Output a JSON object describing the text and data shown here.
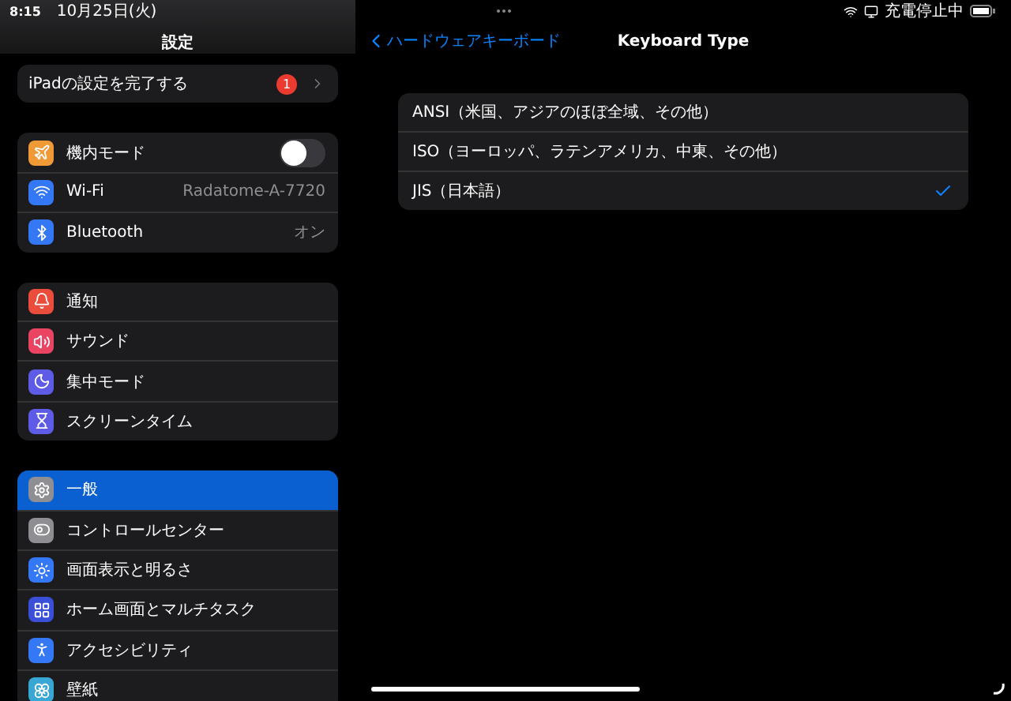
{
  "status_bar": {
    "time": "8:15",
    "date": "10月25日(火)",
    "charging": "充電停止中"
  },
  "sidebar": {
    "title": "設定",
    "setup_row": {
      "label": "iPadの設定を完了する",
      "badge": "1"
    },
    "groups": [
      {
        "items": [
          {
            "kind": "toggle",
            "label": "機内モード",
            "color": "#f09a37",
            "on": false
          },
          {
            "kind": "value",
            "label": "Wi-Fi",
            "color": "#3478f6",
            "value": "Radatome-A-7720"
          },
          {
            "kind": "value",
            "label": "Bluetooth",
            "color": "#3478f6",
            "value": "オン"
          }
        ]
      },
      {
        "items": [
          {
            "kind": "plain",
            "label": "通知",
            "color": "#eb4d3d"
          },
          {
            "kind": "plain",
            "label": "サウンド",
            "color": "#eb4463"
          },
          {
            "kind": "plain",
            "label": "集中モード",
            "color": "#5e5ce6"
          },
          {
            "kind": "plain",
            "label": "スクリーンタイム",
            "color": "#5e5ce6"
          }
        ]
      },
      {
        "items": [
          {
            "kind": "plain",
            "label": "一般",
            "color": "#8e8e93",
            "selected": true
          },
          {
            "kind": "plain",
            "label": "コントロールセンター",
            "color": "#8e8e93",
            "selected": false
          },
          {
            "kind": "plain",
            "label": "画面表示と明るさ",
            "color": "#3478f6",
            "selected": false
          },
          {
            "kind": "plain",
            "label": "ホーム画面とマルチタスク",
            "color": "#3a4fd8",
            "selected": false
          },
          {
            "kind": "plain",
            "label": "アクセシビリティ",
            "color": "#3478f6",
            "selected": false
          },
          {
            "kind": "plain",
            "label": "壁紙",
            "color": "#38a7d4",
            "selected": false
          }
        ]
      }
    ]
  },
  "detail": {
    "back": "ハードウェアキーボード",
    "title": "Keyboard Type",
    "options": [
      {
        "label": "ANSI（米国、アジアのほぼ全域、その他）",
        "selected": false
      },
      {
        "label": "ISO（ヨーロッパ、ラテンアメリカ、中東、その他）",
        "selected": false
      },
      {
        "label": "JIS（日本語）",
        "selected": true
      }
    ]
  }
}
